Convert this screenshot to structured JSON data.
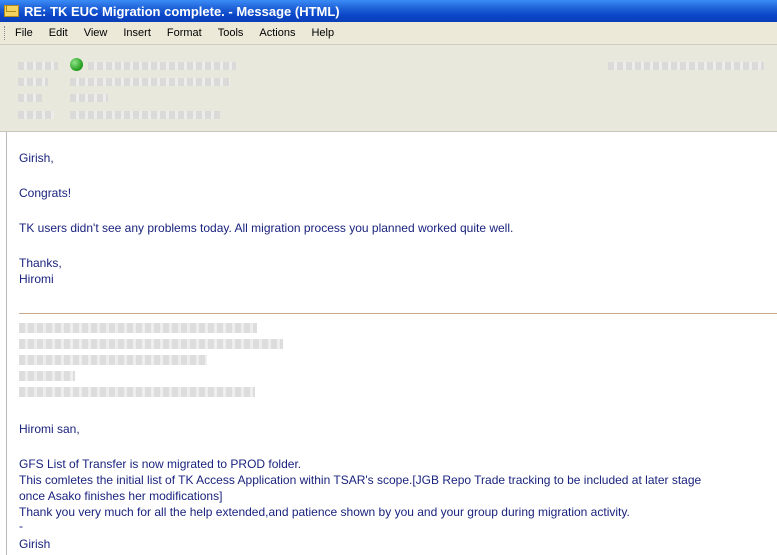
{
  "title": "RE: TK EUC Migration complete. - Message (HTML)",
  "menu": [
    "File",
    "Edit",
    "View",
    "Insert",
    "Format",
    "Tools",
    "Actions",
    "Help"
  ],
  "reply": {
    "greeting": "Girish,",
    "congrats": "Congrats!",
    "line1": "TK users didn't see any problems today.  All migration process you planned worked quite well.",
    "thanks": "Thanks,",
    "signature": "Hiromi"
  },
  "original": {
    "greeting": "Hiromi san,",
    "line1": "GFS List of Transfer is now migrated to PROD folder.",
    "line2": "This comletes the initial list of TK Access Application within TSAR's scope.[JGB Repo Trade tracking to be included at later stage",
    "line3": "once Asako finishes her modifications]",
    "line4": "Thank you very much for all the help extended,and patience shown by you and your group during migration activity.",
    "dash": "-",
    "signature": "Girish"
  },
  "colors": {
    "titlebar": "#0a46c8",
    "menubar": "#ece9d8",
    "text": "#1a237e",
    "status": "#1f9b1a"
  }
}
